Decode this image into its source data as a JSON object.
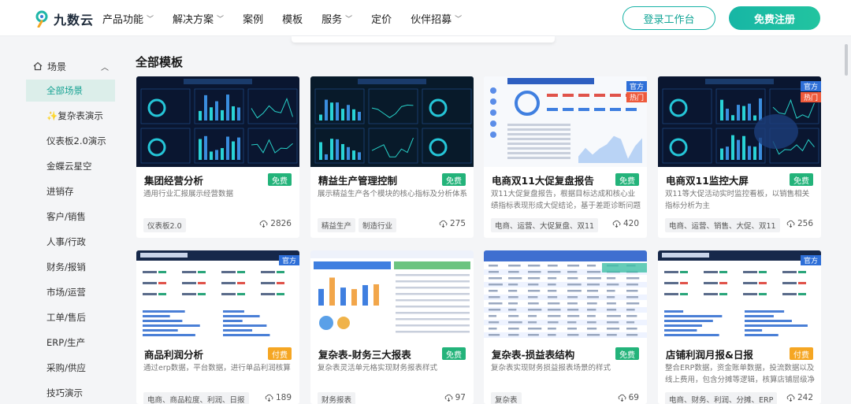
{
  "brand": {
    "name": "九数云"
  },
  "nav": {
    "items": [
      {
        "label": "产品功能",
        "has_dropdown": true
      },
      {
        "label": "解决方案",
        "has_dropdown": true
      },
      {
        "label": "案例",
        "has_dropdown": false
      },
      {
        "label": "模板",
        "has_dropdown": false
      },
      {
        "label": "服务",
        "has_dropdown": true
      },
      {
        "label": "定价",
        "has_dropdown": false
      },
      {
        "label": "伙伴招募",
        "has_dropdown": true
      }
    ],
    "login_label": "登录工作台",
    "register_label": "免费注册"
  },
  "sidebar": {
    "group_label": "场景",
    "items": [
      {
        "label": "全部场景",
        "active": true
      },
      {
        "label": "✨复杂表演示"
      },
      {
        "label": "仪表板2.0演示"
      },
      {
        "label": "金蝶云星空"
      },
      {
        "label": "进销存"
      },
      {
        "label": "客户/销售"
      },
      {
        "label": "人事/行政"
      },
      {
        "label": "财务/报销"
      },
      {
        "label": "市场/运营"
      },
      {
        "label": "工单/售后"
      },
      {
        "label": "ERP/生产"
      },
      {
        "label": "采购/供应"
      },
      {
        "label": "技巧演示"
      }
    ]
  },
  "main": {
    "title": "全部模板",
    "cards": [
      {
        "title": "集团经营分析",
        "price": "免费",
        "price_type": "free",
        "desc": "通用行业汇报展示经营数据",
        "tags": [
          "仪表板2.0"
        ],
        "downloads": "2826",
        "theme": "dark",
        "badges": []
      },
      {
        "title": "精益生产管理控制",
        "price": "免费",
        "price_type": "free",
        "desc": "展示精益生产各个模块的核心指标及分析体系",
        "tags": [
          "精益生产",
          "制造行业"
        ],
        "downloads": "275",
        "theme": "dark2",
        "badges": []
      },
      {
        "title": "电商双11大促复盘报告",
        "price": "免费",
        "price_type": "free",
        "desc": "双11大促复盘报告，根据目标达成和核心业绩指标表现形成大促结论，基于差距诊断问题找到…",
        "tags": [
          "电商、运营、大促复盘、双11"
        ],
        "downloads": "420",
        "theme": "light",
        "badges": [
          "官方",
          "热门"
        ]
      },
      {
        "title": "电商双11监控大屏",
        "price": "免费",
        "price_type": "free",
        "desc": "双11等大促活动实时监控看板，以销售相关指标分析为主",
        "tags": [
          "电商、运营、销售、大促、双11"
        ],
        "downloads": "256",
        "theme": "dark3",
        "badges": [
          "官方",
          "热门"
        ]
      },
      {
        "title": "商品利润分析",
        "price": "付费",
        "price_type": "paid",
        "desc": "通过erp数据，平台数据，进行单品利润核算",
        "tags": [
          "电商、商品粒度、利润、日报"
        ],
        "downloads": "189",
        "theme": "report",
        "badges": [
          "官方"
        ]
      },
      {
        "title": "复杂表-财务三大报表",
        "price": "免费",
        "price_type": "free",
        "desc": "复杂表灵活单元格实现财务报表样式",
        "tags": [
          "财务报表"
        ],
        "downloads": "97",
        "theme": "finance",
        "badges": []
      },
      {
        "title": "复杂表-损益表结构",
        "price": "免费",
        "price_type": "free",
        "desc": "复杂表实现财务损益报表场景的样式",
        "tags": [
          "复杂表"
        ],
        "downloads": "69",
        "theme": "table",
        "badges": []
      },
      {
        "title": "店铺利润月报&日报",
        "price": "付费",
        "price_type": "paid",
        "desc": "整合ERP数据，资金账单数据，投流数据以及线上费用，包含分摊等逻辑，核算店铺层级净利…",
        "tags": [
          "电商、财务、利润、分摊、ERP"
        ],
        "downloads": "242",
        "theme": "report",
        "badges": [
          "官方"
        ]
      }
    ]
  },
  "colors": {
    "accent": "#16a293",
    "free": "#23b37a",
    "paid": "#f5a623",
    "official": "#2e6fd8",
    "hot": "#ee5a3c"
  }
}
